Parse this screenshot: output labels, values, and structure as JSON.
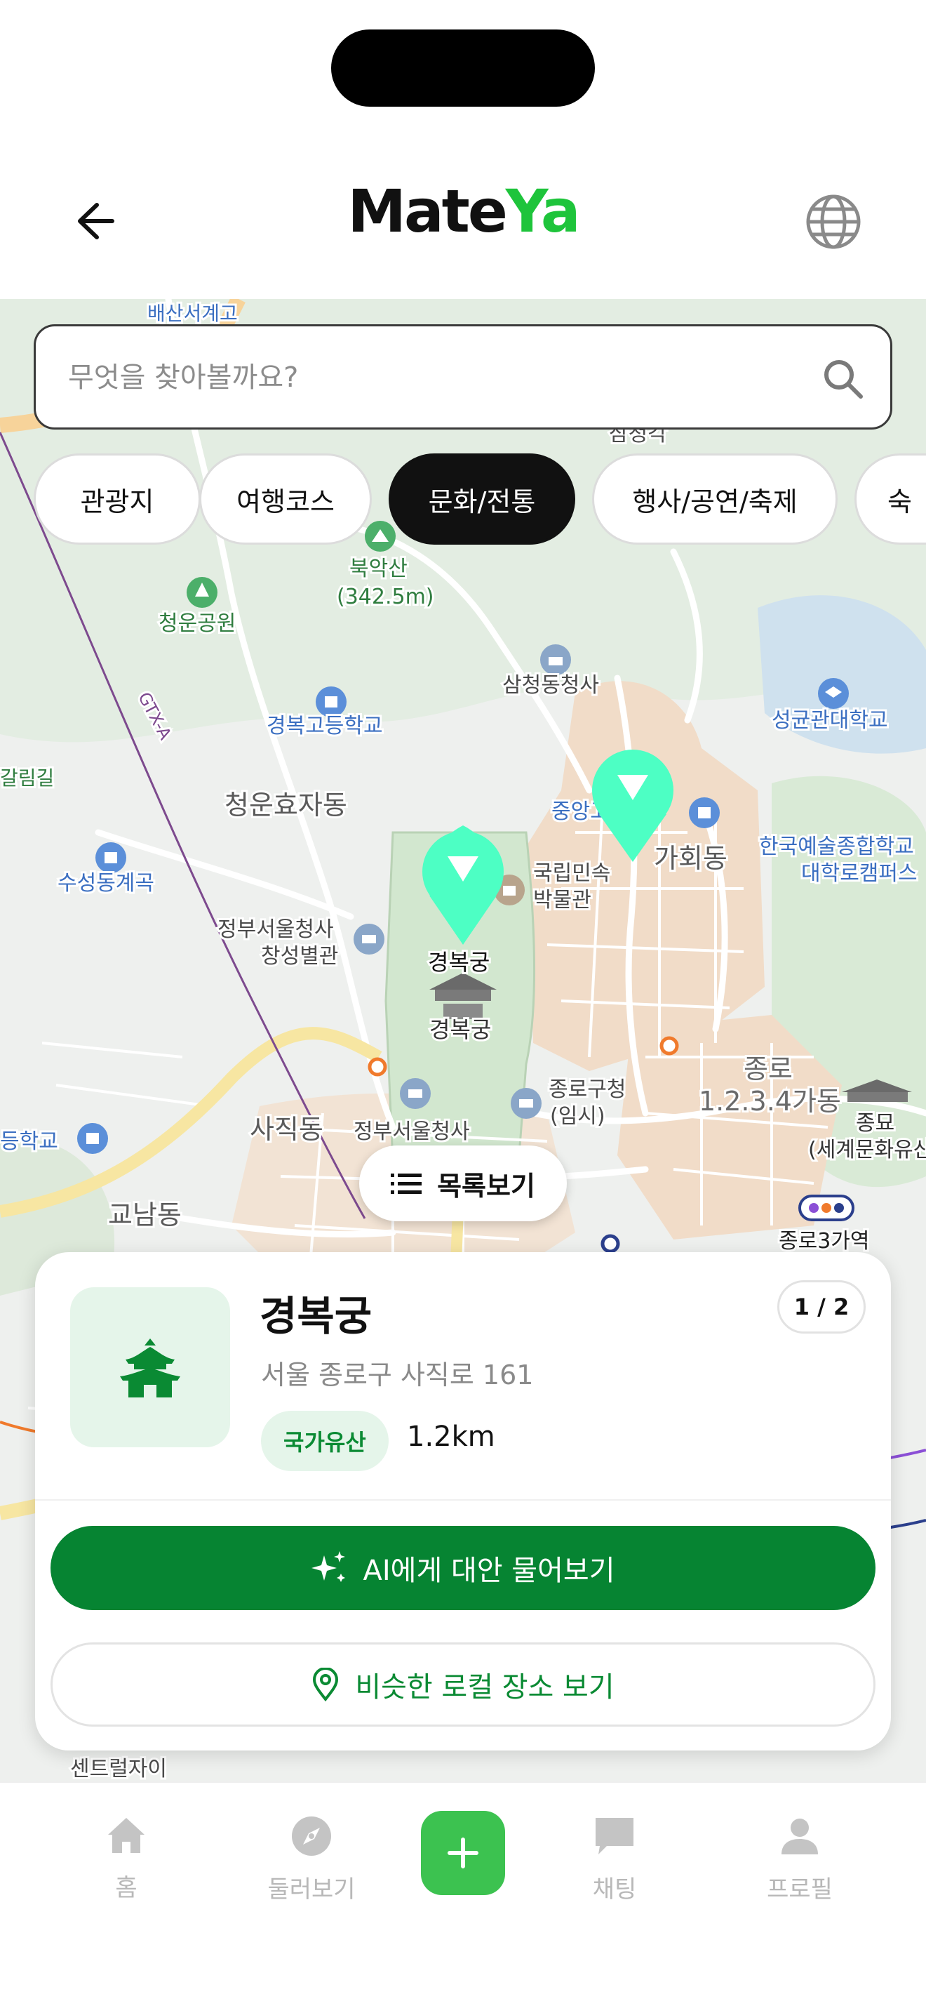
{
  "header": {
    "logo_part1": "Mate",
    "logo_part2": "Ya"
  },
  "search": {
    "placeholder": "무엇을 찾아볼까요?"
  },
  "categories": [
    {
      "label": "관광지",
      "active": false
    },
    {
      "label": "여행코스",
      "active": false
    },
    {
      "label": "문화/전통",
      "active": true
    },
    {
      "label": "행사/공연/축제",
      "active": false
    },
    {
      "label": "숙",
      "active": false
    }
  ],
  "map_labels": {
    "l1": "북악산",
    "l2": "(342.5m)",
    "l3": "청운공원",
    "l4": "삼청동청사",
    "l5": "경복고등학교",
    "l6": "성균관대학교",
    "l7": "청운효자동",
    "l8": "수성동계곡",
    "l9": "국립민속",
    "l10": "박물관",
    "l11": "가회동",
    "l12": "한국예술종합학교",
    "l13": "대학로캠퍼스",
    "l14": "정부서울청사",
    "l15": "창성별관",
    "l16": "경복궁",
    "l17": "경복궁",
    "l18": "사직동",
    "l19": "정부서울청사",
    "l20": "종로구청",
    "l21": "(임시)",
    "l22": "종로",
    "l23": "1.2.3.4가동",
    "l24": "종묘",
    "l25": "(세계문화유산)",
    "l26": "교남동",
    "l27": "종로3가역",
    "l28": "GTX-A",
    "l29": "중앙고",
    "l30": "센트럴자이",
    "l31": "갈림길",
    "l32": "배산서계고",
    "l33": "삼청각",
    "l34": "등학교"
  },
  "list_button": {
    "label": "목록보기"
  },
  "place_card": {
    "name": "경복궁",
    "address": "서울 종로구 사직로 161",
    "tag": "국가유산",
    "distance": "1.2km",
    "pager": "1 / 2",
    "ai_button": "AI에게 대안 물어보기",
    "local_button": "비슷한 로컬 장소 보기"
  },
  "tabbar": {
    "home": "홈",
    "explore": "둘러보기",
    "chat": "채팅",
    "profile": "프로필"
  },
  "colors": {
    "brand_green": "#068432",
    "logo_green": "#1ec43b",
    "marker": "#4dffc4",
    "fab": "#3cc250"
  }
}
